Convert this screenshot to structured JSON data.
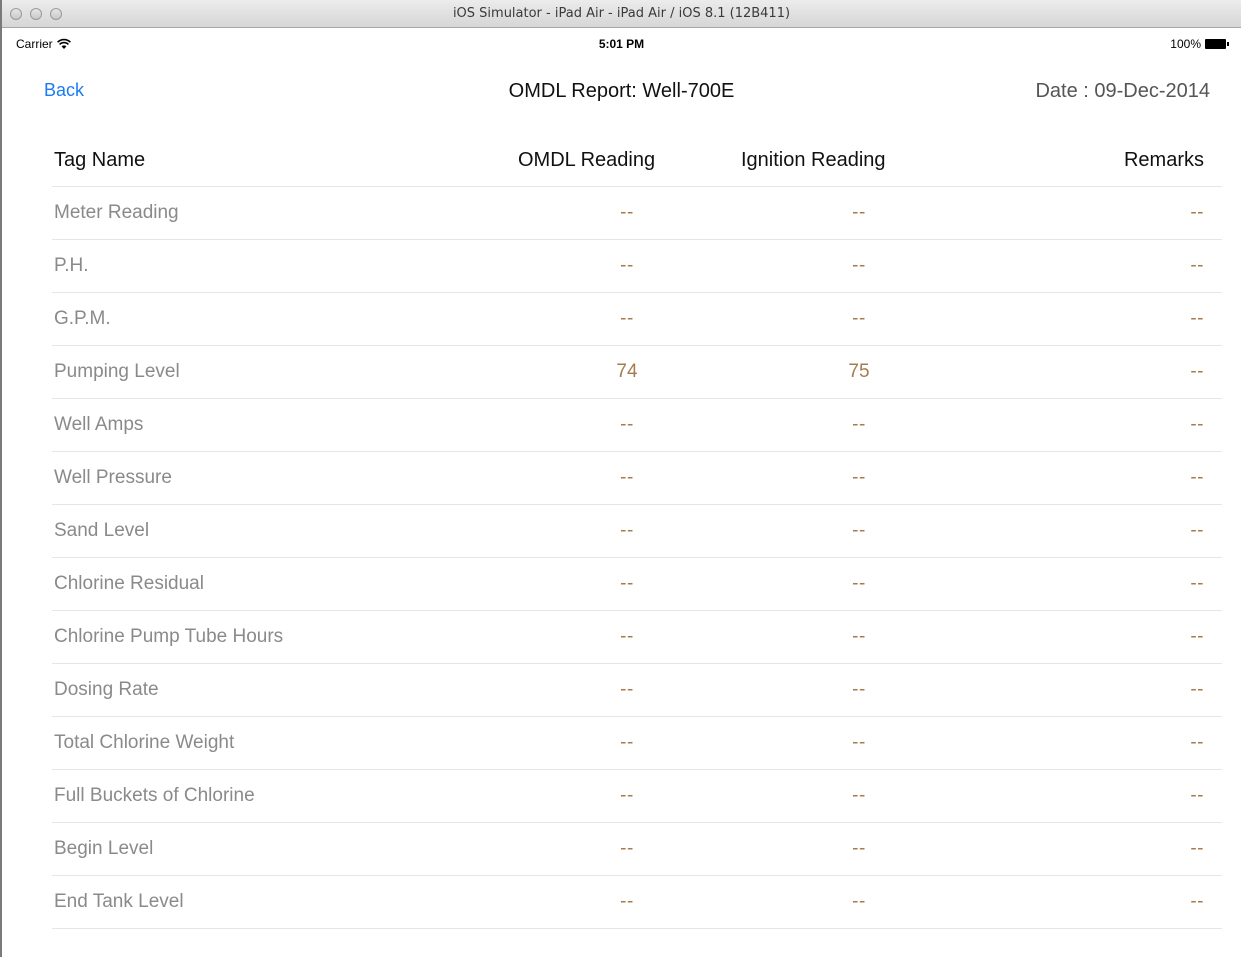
{
  "window": {
    "title": "iOS Simulator - iPad Air - iPad Air / iOS 8.1 (12B411)"
  },
  "status_bar": {
    "carrier": "Carrier",
    "time": "5:01 PM",
    "battery": "100%"
  },
  "nav": {
    "back_label": "Back",
    "title": "OMDL Report: Well-700E",
    "date": "Date : 09-Dec-2014",
    "accent_color": "#1a7cf5"
  },
  "table": {
    "headers": {
      "tag": "Tag Name",
      "omdl": "OMDL Reading",
      "ignition": "Ignition Reading",
      "remarks": "Remarks"
    },
    "rows": [
      {
        "tag": "Meter Reading",
        "omdl": "--",
        "ignition": "--",
        "remarks": "--"
      },
      {
        "tag": "P.H.",
        "omdl": "--",
        "ignition": "--",
        "remarks": "--"
      },
      {
        "tag": "G.P.M.",
        "omdl": "--",
        "ignition": "--",
        "remarks": "--"
      },
      {
        "tag": "Pumping Level",
        "omdl": "74",
        "ignition": "75",
        "remarks": "--"
      },
      {
        "tag": "Well Amps",
        "omdl": "--",
        "ignition": "--",
        "remarks": "--"
      },
      {
        "tag": "Well Pressure",
        "omdl": "--",
        "ignition": "--",
        "remarks": "--"
      },
      {
        "tag": "Sand Level",
        "omdl": "--",
        "ignition": "--",
        "remarks": "--"
      },
      {
        "tag": "Chlorine Residual",
        "omdl": "--",
        "ignition": "--",
        "remarks": "--"
      },
      {
        "tag": "Chlorine Pump Tube Hours",
        "omdl": "--",
        "ignition": "--",
        "remarks": "--"
      },
      {
        "tag": "Dosing Rate",
        "omdl": "--",
        "ignition": "--",
        "remarks": "--"
      },
      {
        "tag": "Total Chlorine Weight",
        "omdl": "--",
        "ignition": "--",
        "remarks": "--"
      },
      {
        "tag": "Full Buckets of Chlorine",
        "omdl": "--",
        "ignition": "--",
        "remarks": "--"
      },
      {
        "tag": "Begin Level",
        "omdl": "--",
        "ignition": "--",
        "remarks": "--"
      },
      {
        "tag": "End Tank Level",
        "omdl": "--",
        "ignition": "--",
        "remarks": "--"
      }
    ]
  }
}
